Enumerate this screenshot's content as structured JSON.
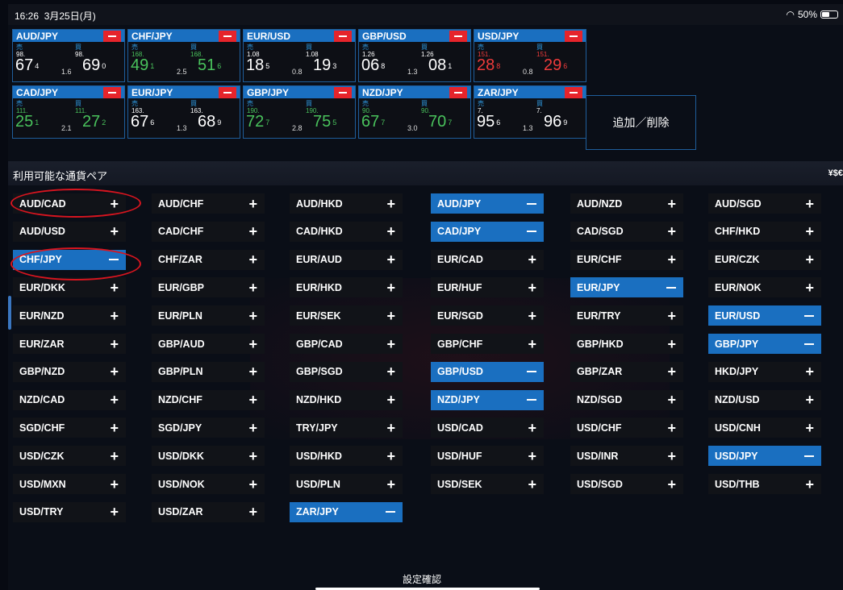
{
  "status": {
    "time": "16:26",
    "date": "3月25日(月)",
    "battery": "50%",
    "battery_level": 0.5,
    "wifi_icon": "wifi-icon",
    "battery_icon": "battery-icon"
  },
  "tiles": [
    {
      "pair": "AUD/JPY",
      "sell_label": "売",
      "buy_label": "買",
      "sell_pre": "98.",
      "sell_main": "67",
      "sell_sup": "4",
      "spread": "1.6",
      "buy_pre": "98.",
      "buy_main": "69",
      "buy_sup": "0",
      "color": "white"
    },
    {
      "pair": "CHF/JPY",
      "sell_label": "売",
      "buy_label": "買",
      "sell_pre": "168.",
      "sell_main": "49",
      "sell_sup": "1",
      "spread": "2.5",
      "buy_pre": "168.",
      "buy_main": "51",
      "buy_sup": "6",
      "color": "green"
    },
    {
      "pair": "EUR/USD",
      "sell_label": "売",
      "buy_label": "買",
      "sell_pre": "1.08",
      "sell_main": "18",
      "sell_sup": "5",
      "spread": "0.8",
      "buy_pre": "1.08",
      "buy_main": "19",
      "buy_sup": "3",
      "color": "white"
    },
    {
      "pair": "GBP/USD",
      "sell_label": "売",
      "buy_label": "買",
      "sell_pre": "1.26",
      "sell_main": "06",
      "sell_sup": "8",
      "spread": "1.3",
      "buy_pre": "1.26",
      "buy_main": "08",
      "buy_sup": "1",
      "color": "white"
    },
    {
      "pair": "USD/JPY",
      "sell_label": "売",
      "buy_label": "買",
      "sell_pre": "151.",
      "sell_main": "28",
      "sell_sup": "8",
      "spread": "0.8",
      "buy_pre": "151.",
      "buy_main": "29",
      "buy_sup": "6",
      "color": "red"
    },
    {
      "pair": "CAD/JPY",
      "sell_label": "売",
      "buy_label": "買",
      "sell_pre": "111.",
      "sell_main": "25",
      "sell_sup": "1",
      "spread": "2.1",
      "buy_pre": "111.",
      "buy_main": "27",
      "buy_sup": "2",
      "color": "green"
    },
    {
      "pair": "EUR/JPY",
      "sell_label": "売",
      "buy_label": "買",
      "sell_pre": "163.",
      "sell_main": "67",
      "sell_sup": "6",
      "spread": "1.3",
      "buy_pre": "163.",
      "buy_main": "68",
      "buy_sup": "9",
      "color": "white"
    },
    {
      "pair": "GBP/JPY",
      "sell_label": "売",
      "buy_label": "買",
      "sell_pre": "190.",
      "sell_main": "72",
      "sell_sup": "7",
      "spread": "2.8",
      "buy_pre": "190.",
      "buy_main": "75",
      "buy_sup": "5",
      "color": "green"
    },
    {
      "pair": "NZD/JPY",
      "sell_label": "売",
      "buy_label": "買",
      "sell_pre": "90.",
      "sell_main": "67",
      "sell_sup": "7",
      "spread": "3.0",
      "buy_pre": "90.",
      "buy_main": "70",
      "buy_sup": "7",
      "color": "green"
    },
    {
      "pair": "ZAR/JPY",
      "sell_label": "売",
      "buy_label": "買",
      "sell_pre": "7.",
      "sell_main": "95",
      "sell_sup": "6",
      "spread": "1.3",
      "buy_pre": "7.",
      "buy_main": "96",
      "buy_sup": "9",
      "color": "white"
    }
  ],
  "add_delete_label": "追加／削除",
  "section": {
    "title": "利用可能な通貨ペア",
    "currency_symbols": "¥$€"
  },
  "pairs": [
    [
      "AUD/CAD",
      "AUD/CHF",
      "AUD/HKD",
      "AUD/JPY",
      "AUD/NZD",
      "AUD/SGD"
    ],
    [
      "AUD/USD",
      "CAD/CHF",
      "CAD/HKD",
      "CAD/JPY",
      "CAD/SGD",
      "CHF/HKD"
    ],
    [
      "CHF/JPY",
      "CHF/ZAR",
      "EUR/AUD",
      "EUR/CAD",
      "EUR/CHF",
      "EUR/CZK"
    ],
    [
      "EUR/DKK",
      "EUR/GBP",
      "EUR/HKD",
      "EUR/HUF",
      "EUR/JPY",
      "EUR/NOK"
    ],
    [
      "EUR/NZD",
      "EUR/PLN",
      "EUR/SEK",
      "EUR/SGD",
      "EUR/TRY",
      "EUR/USD"
    ],
    [
      "EUR/ZAR",
      "GBP/AUD",
      "GBP/CAD",
      "GBP/CHF",
      "GBP/HKD",
      "GBP/JPY"
    ],
    [
      "GBP/NZD",
      "GBP/PLN",
      "GBP/SGD",
      "GBP/USD",
      "GBP/ZAR",
      "HKD/JPY"
    ],
    [
      "NZD/CAD",
      "NZD/CHF",
      "NZD/HKD",
      "NZD/JPY",
      "NZD/SGD",
      "NZD/USD"
    ],
    [
      "SGD/CHF",
      "SGD/JPY",
      "TRY/JPY",
      "USD/CAD",
      "USD/CHF",
      "USD/CNH"
    ],
    [
      "USD/CZK",
      "USD/DKK",
      "USD/HKD",
      "USD/HUF",
      "USD/INR",
      "USD/JPY"
    ],
    [
      "USD/MXN",
      "USD/NOK",
      "USD/PLN",
      "USD/SEK",
      "USD/SGD",
      "USD/THB"
    ],
    [
      "USD/TRY",
      "USD/ZAR",
      "ZAR/JPY"
    ]
  ],
  "selected_pairs": [
    "AUD/JPY",
    "CAD/JPY",
    "CHF/JPY",
    "EUR/JPY",
    "EUR/USD",
    "GBP/JPY",
    "GBP/USD",
    "NZD/JPY",
    "USD/JPY",
    "ZAR/JPY"
  ],
  "highlighted_pairs": [
    "AUD/CAD",
    "CHF/JPY"
  ],
  "add_icon": "plus-icon",
  "remove_icon": "minus-icon",
  "confirm_label": "設定確認",
  "colors": {
    "accent": "#1a6fc0",
    "remove": "#e6242b",
    "highlight_ring": "#d8151f",
    "up": "#49c25c",
    "down": "#ee3b3b"
  }
}
